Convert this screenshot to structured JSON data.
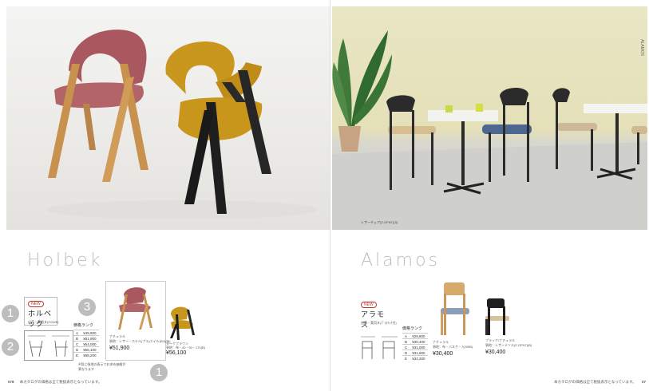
{
  "left": {
    "series_name": "Holbek",
    "product_jname": "ホルベック",
    "new_tag": "NEW",
    "size_note": "出荷・実用ヌ(OOUB)",
    "rank_title": "価格ランク",
    "rank_rows": [
      {
        "rank": "A",
        "price": "¥49,900"
      },
      {
        "rank": "B",
        "price": "¥51,900"
      },
      {
        "rank": "C",
        "price": "¥54,000"
      },
      {
        "rank": "D",
        "price": "¥56,100"
      },
      {
        "rank": "E",
        "price": "¥58,200"
      }
    ],
    "rank_note": "※背に張地の表示でお求め価格が異なります",
    "variant1": {
      "name": "ナチュラル",
      "spec": "張地：レザー・ホテル(プラ)ツイル(B2)(Bi)",
      "price": "¥51,900"
    },
    "variant2": {
      "name": "ダークブラウン",
      "spec": "張地：布・40・90・170(B)",
      "price": "¥56,100"
    },
    "callouts": [
      "1",
      "2",
      "3",
      "1"
    ],
    "page_number": "078",
    "footer_note": "本カタログの価格は全て税抜表示となっています。"
  },
  "right": {
    "series_name": "Alamos",
    "product_jname": "アラモス",
    "new_tag": "NEW",
    "size_note": "出荷・実用ヌ(ﾌﾟﾗｽﾁｯｸ付)",
    "photo_caption": "レザーチェア(Z-GFN7)(3)",
    "rank_title": "価格ランク",
    "rank_rows": [
      {
        "rank": "A",
        "price": "¥29,800"
      },
      {
        "rank": "B",
        "price": "¥30,400"
      },
      {
        "rank": "C",
        "price": "¥31,000"
      },
      {
        "rank": "D",
        "price": "¥31,600"
      },
      {
        "rank": "E",
        "price": "¥32,200"
      }
    ],
    "variant1": {
      "name": "ナチュラル",
      "spec": "張地：布・バスケ・7(200B)",
      "price": "¥30,400"
    },
    "variant2": {
      "name": "ブラック/ナチュラル",
      "spec": "張地：レザーメソル(Z-GFN7)(B)",
      "price": "¥30,400"
    },
    "side_tab": "ALAMOS",
    "page_number": "07",
    "footer_note": "本カタログの価格は全て税抜表示となっています。"
  }
}
